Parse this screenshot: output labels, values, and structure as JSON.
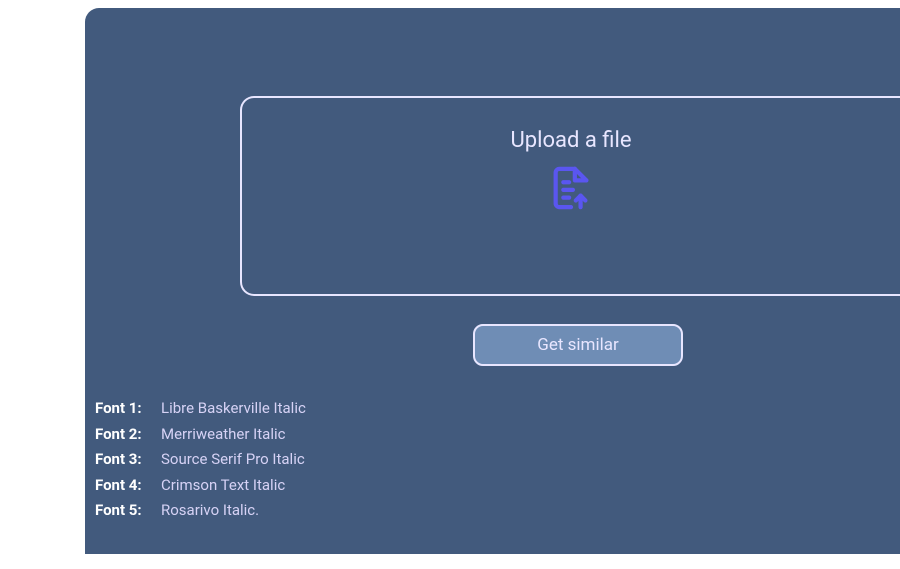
{
  "upload": {
    "title": "Upload a file"
  },
  "button": {
    "get_similar": "Get similar"
  },
  "fonts": [
    {
      "label": "Font 1:",
      "name": "Libre Baskerville Italic"
    },
    {
      "label": "Font 2:",
      "name": "Merriweather Italic"
    },
    {
      "label": "Font 3:",
      "name": "Source Serif Pro Italic"
    },
    {
      "label": "Font 4:",
      "name": "Crimson Text Italic"
    },
    {
      "label": "Font 5:",
      "name": "Rosarivo Italic."
    }
  ]
}
